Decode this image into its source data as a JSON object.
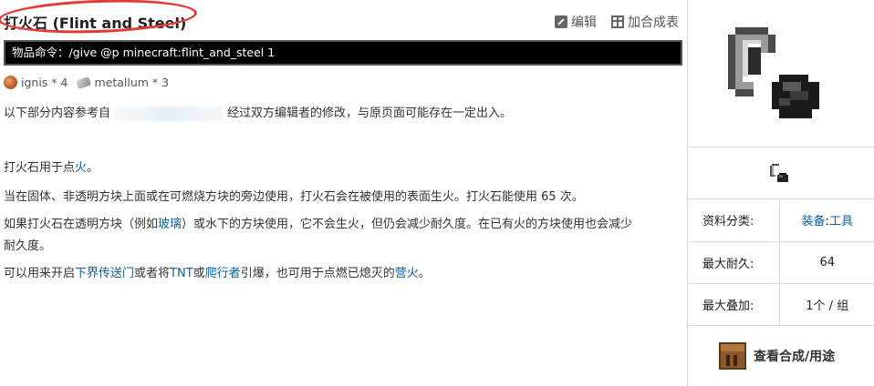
{
  "header": {
    "title": "打火石 (Flint and Steel)",
    "edit_label": "编辑",
    "add_recipe_label": "加合成表"
  },
  "command": {
    "text": "物品命令：/give @p minecraft:flint_and_steel 1"
  },
  "aspects": [
    {
      "label": "ignis * 4",
      "icon": "ignis-icon"
    },
    {
      "label": "metallum * 3",
      "icon": "metallum-icon"
    }
  ],
  "notice": {
    "prefix": "以下部分内容参考自",
    "suffix": "经过双方编辑者的修改，与原页面可能存在一定出入。"
  },
  "content": {
    "p1_a": "打火石用于点",
    "p1_link": "火",
    "p1_b": "。",
    "p2": "当在固体、非透明方块上面或在可燃烧方块的旁边使用，打火石会在被使用的表面生火。打火石能使用 65 次。",
    "p3_a": "如果打火石在透明方块（例如",
    "p3_link": "玻璃",
    "p3_b": "）或水下的方块使用，它不会生火，但仍会减少耐久度。在已有火的方块使用也会减少",
    "p3_c": "耐久度。",
    "p4_a": "可以用来开启",
    "p4_link1": "下界传送门",
    "p4_b": "或者将",
    "p4_link2": "TNT",
    "p4_c": "或",
    "p4_link3": "爬行者",
    "p4_d": "引爆，也可用于点燃已熄灭的",
    "p4_link4": "营火",
    "p4_e": "。"
  },
  "sidebar": {
    "rows": [
      {
        "key": "资料分类:",
        "value_link1": "装备",
        "value_sep": ":",
        "value_link2": "工具"
      },
      {
        "key": "最大耐久:",
        "value": "64"
      },
      {
        "key": "最大叠加:",
        "value": "1个 / 组"
      }
    ],
    "view_recipe_label": "查看合成/用途"
  },
  "colors": {
    "link": "#0b61a4",
    "highlight_circle": "#e53935",
    "command_bg": "#000000"
  }
}
